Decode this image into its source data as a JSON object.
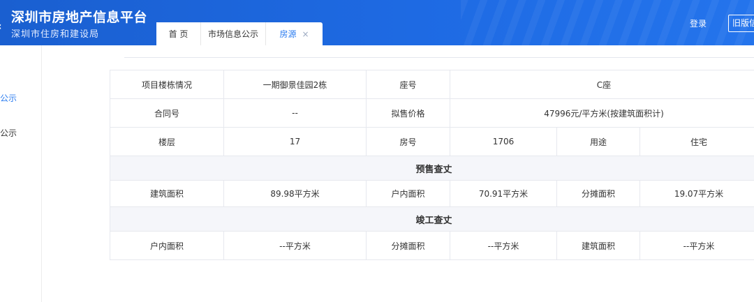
{
  "header": {
    "brand_title": "深圳市房地产信息平台",
    "brand_subtitle": "深圳市住房和建设局",
    "tabs": [
      {
        "label": "首 页"
      },
      {
        "label": "市场信息公示"
      },
      {
        "label": "房源",
        "close": "×",
        "active": true
      }
    ],
    "login_label": "登录",
    "old_version_label": "旧版信"
  },
  "sidebar": {
    "items": [
      {
        "label": "公示",
        "active": true
      },
      {
        "label": "公示"
      }
    ]
  },
  "table": {
    "row1": {
      "c1": "项目楼栋情况",
      "c2": "一期御景佳园2栋",
      "c3": "座号",
      "c4": "C座"
    },
    "row2": {
      "c1": "合同号",
      "c2": "--",
      "c3": "拟售价格",
      "c4": "47996元/平方米(按建筑面积计)"
    },
    "row3": {
      "c1": "楼层",
      "c2": "17",
      "c3": "房号",
      "c4": "1706",
      "c5": "用途",
      "c6": "住宅"
    },
    "presale_title": "预售查丈",
    "row4": {
      "c1": "建筑面积",
      "c2": "89.98平方米",
      "c3": "户内面积",
      "c4": "70.91平方米",
      "c5": "分摊面积",
      "c6": "19.07平方米"
    },
    "completion_title": "竣工查丈",
    "row5": {
      "c1": "户内面积",
      "c2": "--平方米",
      "c3": "分摊面积",
      "c4": "--平方米",
      "c5": "建筑面积",
      "c6": "--平方米"
    }
  },
  "colors": {
    "header_blue": "#1e6ae3",
    "accent_blue": "#2b7cf0",
    "section_bg": "#f5f6fa",
    "border": "#e6e8ee"
  }
}
